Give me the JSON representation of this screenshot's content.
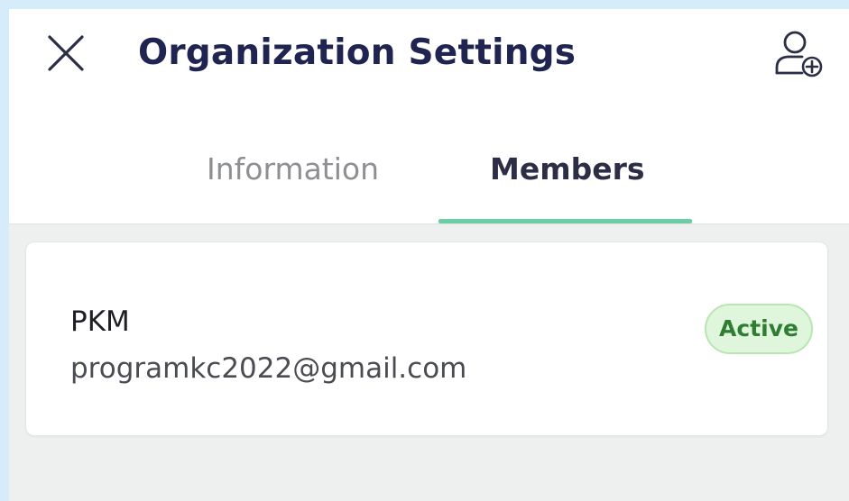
{
  "header": {
    "title": "Organization Settings",
    "close_icon": "close-icon",
    "add_member_icon": "add-user-icon"
  },
  "tabs": [
    {
      "label": "Information",
      "selected": false
    },
    {
      "label": "Members",
      "selected": true
    }
  ],
  "members": [
    {
      "name": "PKM",
      "email": "programkc2022@gmail.com",
      "status": "Active"
    }
  ],
  "colors": {
    "title": "#1f2450",
    "tab_indicator": "#6bcfa6",
    "status_active_bg": "#dff6dc",
    "status_active_text": "#2f7d33"
  }
}
